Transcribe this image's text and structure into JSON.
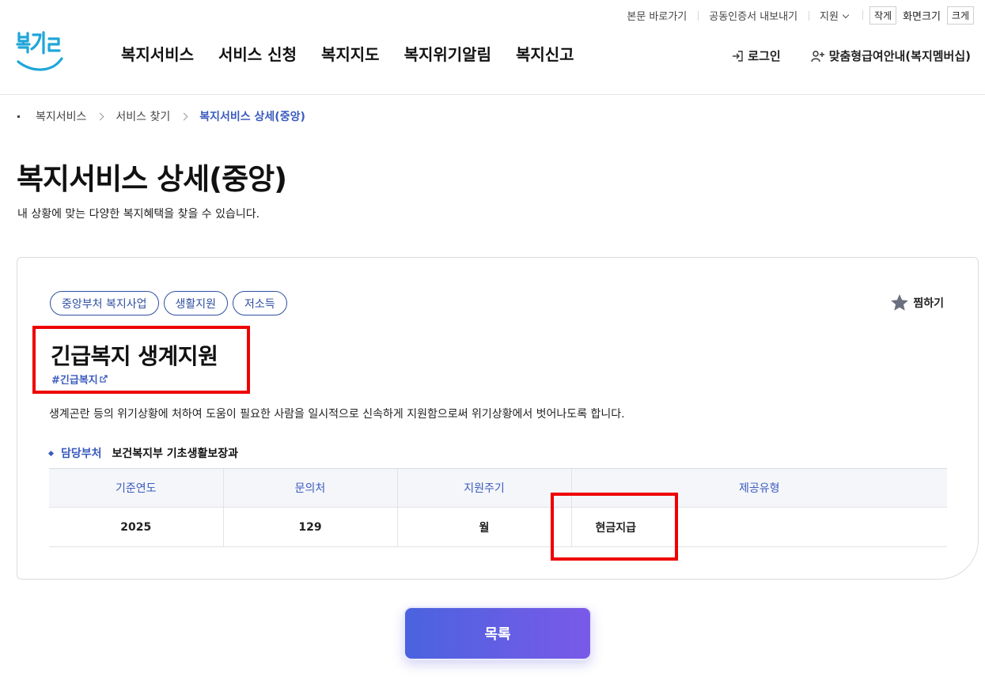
{
  "util": {
    "skip": "본문 바로가기",
    "cert": "공동인증서 내보내기",
    "support": "지원",
    "small": "작게",
    "font_size": "화면크기",
    "large": "크게"
  },
  "logo_text": "복지로",
  "nav": [
    "복지서비스",
    "서비스 신청",
    "복지지도",
    "복지위기알림",
    "복지신고"
  ],
  "header": {
    "login": "로그인",
    "member": "맞춤형급여안내(복지멤버십)"
  },
  "breadcrumb": [
    "복지서비스",
    "서비스 찾기",
    "복지서비스 상세(중앙)"
  ],
  "page": {
    "title": "복지서비스 상세(중앙)",
    "subtitle": "내 상황에 맞는 다양한 복지혜택을 찾을 수 있습니다."
  },
  "service": {
    "tags": [
      "중앙부처 복지사업",
      "생활지원",
      "저소득"
    ],
    "favorite": "찜하기",
    "title": "긴급복지 생계지원",
    "hashtag": "#긴급복지",
    "description": "생계곤란 등의 위기상황에 처하여 도움이 필요한 사람을 일시적으로 신속하게 지원함으로써 위기상황에서 벗어나도록 합니다.",
    "dept_label": "담당부처",
    "dept_value": "보건복지부 기초생활보장과",
    "table": {
      "headers": [
        "기준연도",
        "문의처",
        "지원주기",
        "제공유형"
      ],
      "row": [
        "2025",
        "129",
        "월",
        "현금지급"
      ]
    }
  },
  "list_button": "목록",
  "colors": {
    "accent": "#3a5bbf",
    "button_start": "#4a63de",
    "button_end": "#7a5ae8",
    "highlight": "#ee0000"
  }
}
